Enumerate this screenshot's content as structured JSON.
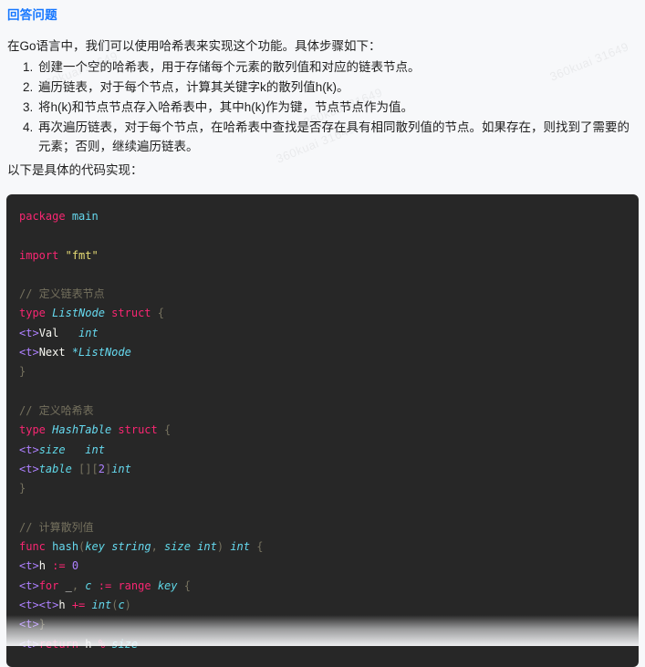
{
  "heading": "回答问题",
  "intro": "在Go语言中，我们可以使用哈希表来实现这个功能。具体步骤如下：",
  "steps": [
    "创建一个空的哈希表，用于存储每个元素的散列值和对应的链表节点。",
    "遍历链表，对于每个节点，计算其关键字k的散列值h(k)。",
    "将h(k)和节点节点存入哈希表中，其中h(k)作为键，节点节点作为值。",
    "再次遍历链表，对于每个节点，在哈希表中查找是否存在具有相同散列值的节点。如果存在，则找到了需要的元素；否则，继续遍历链表。"
  ],
  "outro": "以下是具体的代码实现：",
  "colors": {
    "page_background": "#f7f8fa",
    "heading_blue": "#1677ff",
    "body_text": "#1f1f1f",
    "code_background": "#272727",
    "token_keyword": "#f92672",
    "token_type": "#66d9ef",
    "token_string": "#e6db74",
    "token_number": "#ae81ff",
    "token_comment": "#75715e",
    "token_plain": "#f8f8f2"
  },
  "code": {
    "language": "go",
    "lines": [
      [
        {
          "t": "package",
          "c": "tok-key"
        },
        {
          "t": " ",
          "c": "tok-plain"
        },
        {
          "t": "main",
          "c": "tok-fn"
        }
      ],
      [],
      [
        {
          "t": "import",
          "c": "tok-key"
        },
        {
          "t": " ",
          "c": "tok-plain"
        },
        {
          "t": "\"fmt\"",
          "c": "tok-str"
        }
      ],
      [],
      [
        {
          "t": "// 定义链表节点",
          "c": "tok-com"
        }
      ],
      [
        {
          "t": "type",
          "c": "tok-key"
        },
        {
          "t": " ",
          "c": "tok-plain"
        },
        {
          "t": "ListNode",
          "c": "tok-type"
        },
        {
          "t": " ",
          "c": "tok-plain"
        },
        {
          "t": "struct",
          "c": "tok-key"
        },
        {
          "t": " ",
          "c": "tok-plain"
        },
        {
          "t": "{",
          "c": "tok-com"
        }
      ],
      [
        {
          "t": "<t>",
          "c": "tok-tag"
        },
        {
          "t": "Val",
          "c": "tok-plain"
        },
        {
          "t": "   ",
          "c": "tok-plain"
        },
        {
          "t": "int",
          "c": "tok-type"
        }
      ],
      [
        {
          "t": "<t>",
          "c": "tok-tag"
        },
        {
          "t": "Next",
          "c": "tok-plain"
        },
        {
          "t": " ",
          "c": "tok-plain"
        },
        {
          "t": "*ListNode",
          "c": "tok-type"
        }
      ],
      [
        {
          "t": "}",
          "c": "tok-com"
        }
      ],
      [],
      [
        {
          "t": "// 定义哈希表",
          "c": "tok-com"
        }
      ],
      [
        {
          "t": "type",
          "c": "tok-key"
        },
        {
          "t": " ",
          "c": "tok-plain"
        },
        {
          "t": "HashTable",
          "c": "tok-type"
        },
        {
          "t": " ",
          "c": "tok-plain"
        },
        {
          "t": "struct",
          "c": "tok-key"
        },
        {
          "t": " ",
          "c": "tok-plain"
        },
        {
          "t": "{",
          "c": "tok-com"
        }
      ],
      [
        {
          "t": "<t>",
          "c": "tok-tag"
        },
        {
          "t": "size",
          "c": "tok-param"
        },
        {
          "t": "   ",
          "c": "tok-plain"
        },
        {
          "t": "int",
          "c": "tok-type"
        }
      ],
      [
        {
          "t": "<t>",
          "c": "tok-tag"
        },
        {
          "t": "table",
          "c": "tok-param"
        },
        {
          "t": " ",
          "c": "tok-plain"
        },
        {
          "t": "[]",
          "c": "tok-com"
        },
        {
          "t": "[",
          "c": "tok-com"
        },
        {
          "t": "2",
          "c": "tok-num"
        },
        {
          "t": "]",
          "c": "tok-com"
        },
        {
          "t": "int",
          "c": "tok-type"
        }
      ],
      [
        {
          "t": "}",
          "c": "tok-com"
        }
      ],
      [],
      [
        {
          "t": "// 计算散列值",
          "c": "tok-com"
        }
      ],
      [
        {
          "t": "func",
          "c": "tok-key"
        },
        {
          "t": " ",
          "c": "tok-plain"
        },
        {
          "t": "hash",
          "c": "tok-fn"
        },
        {
          "t": "(",
          "c": "tok-com"
        },
        {
          "t": "key",
          "c": "tok-param"
        },
        {
          "t": " ",
          "c": "tok-plain"
        },
        {
          "t": "string",
          "c": "tok-type"
        },
        {
          "t": ", ",
          "c": "tok-com"
        },
        {
          "t": "size",
          "c": "tok-param"
        },
        {
          "t": " ",
          "c": "tok-plain"
        },
        {
          "t": "int",
          "c": "tok-type"
        },
        {
          "t": ")",
          "c": "tok-com"
        },
        {
          "t": " ",
          "c": "tok-plain"
        },
        {
          "t": "int",
          "c": "tok-type"
        },
        {
          "t": " ",
          "c": "tok-plain"
        },
        {
          "t": "{",
          "c": "tok-com"
        }
      ],
      [
        {
          "t": "<t>",
          "c": "tok-tag"
        },
        {
          "t": "h",
          "c": "tok-plain"
        },
        {
          "t": " ",
          "c": "tok-plain"
        },
        {
          "t": ":=",
          "c": "tok-op"
        },
        {
          "t": " ",
          "c": "tok-plain"
        },
        {
          "t": "0",
          "c": "tok-num"
        }
      ],
      [
        {
          "t": "<t>",
          "c": "tok-tag"
        },
        {
          "t": "for",
          "c": "tok-key"
        },
        {
          "t": " ",
          "c": "tok-plain"
        },
        {
          "t": "_",
          "c": "tok-plain"
        },
        {
          "t": ", ",
          "c": "tok-com"
        },
        {
          "t": "c",
          "c": "tok-param"
        },
        {
          "t": " ",
          "c": "tok-plain"
        },
        {
          "t": ":=",
          "c": "tok-op"
        },
        {
          "t": " ",
          "c": "tok-plain"
        },
        {
          "t": "range",
          "c": "tok-key"
        },
        {
          "t": " ",
          "c": "tok-plain"
        },
        {
          "t": "key",
          "c": "tok-param"
        },
        {
          "t": " ",
          "c": "tok-plain"
        },
        {
          "t": "{",
          "c": "tok-com"
        }
      ],
      [
        {
          "t": "<t><t>",
          "c": "tok-tag"
        },
        {
          "t": "h",
          "c": "tok-plain"
        },
        {
          "t": " ",
          "c": "tok-plain"
        },
        {
          "t": "+=",
          "c": "tok-op"
        },
        {
          "t": " ",
          "c": "tok-plain"
        },
        {
          "t": "int",
          "c": "tok-type"
        },
        {
          "t": "(",
          "c": "tok-com"
        },
        {
          "t": "c",
          "c": "tok-param"
        },
        {
          "t": ")",
          "c": "tok-com"
        }
      ],
      [
        {
          "t": "<t>",
          "c": "tok-tag"
        },
        {
          "t": "}",
          "c": "tok-com"
        }
      ],
      [
        {
          "t": "<t>",
          "c": "tok-tag"
        },
        {
          "t": "return",
          "c": "tok-key"
        },
        {
          "t": " ",
          "c": "tok-plain"
        },
        {
          "t": "h",
          "c": "tok-plain"
        },
        {
          "t": " ",
          "c": "tok-plain"
        },
        {
          "t": "%",
          "c": "tok-op"
        },
        {
          "t": " ",
          "c": "tok-plain"
        },
        {
          "t": "size",
          "c": "tok-param"
        }
      ]
    ]
  },
  "watermarks": [
    "360kuai 31649",
    "360kuai 31649",
    "360kuai 31649",
    "360kuai 31649",
    "360kuai 31649",
    "360kuai 31649"
  ]
}
